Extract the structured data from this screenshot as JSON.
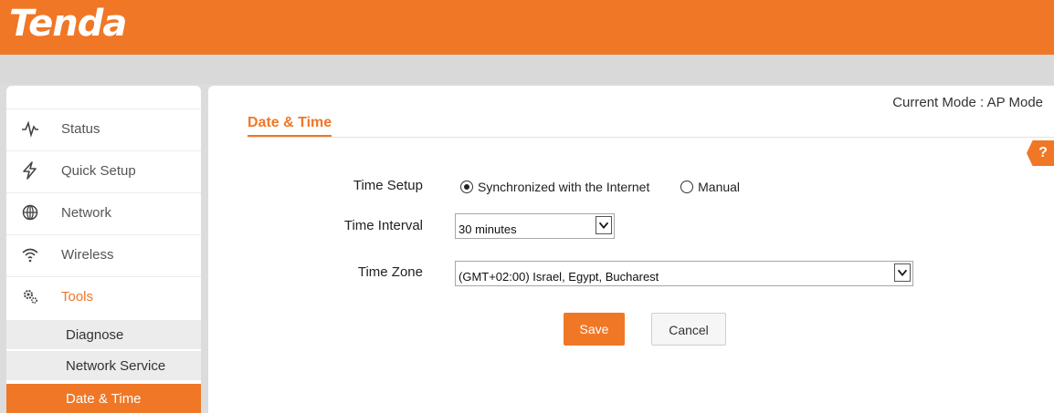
{
  "header": {
    "logo_text": "Tenda",
    "brand_color": "#f07726"
  },
  "sidebar": {
    "items": [
      {
        "label": "Status",
        "icon": "pulse-icon"
      },
      {
        "label": "Quick Setup",
        "icon": "lightning-icon"
      },
      {
        "label": "Network",
        "icon": "globe-icon"
      },
      {
        "label": "Wireless",
        "icon": "wifi-icon"
      },
      {
        "label": "Tools",
        "icon": "gears-icon",
        "active": true
      }
    ],
    "sub_items": [
      {
        "label": "Diagnose"
      },
      {
        "label": "Network Service"
      },
      {
        "label": "Date & Time",
        "active": true
      }
    ]
  },
  "main": {
    "mode_text": "Current Mode : AP Mode",
    "title": "Date & Time",
    "help_label": "?",
    "time_setup": {
      "label": "Time Setup",
      "options": [
        "Synchronized with the Internet",
        "Manual"
      ],
      "selected": "Synchronized with the Internet"
    },
    "time_interval": {
      "label": "Time Interval",
      "value": "30 minutes"
    },
    "time_zone": {
      "label": "Time Zone",
      "value": "(GMT+02:00) Israel, Egypt, Bucharest"
    },
    "save_label": "Save",
    "cancel_label": "Cancel"
  }
}
